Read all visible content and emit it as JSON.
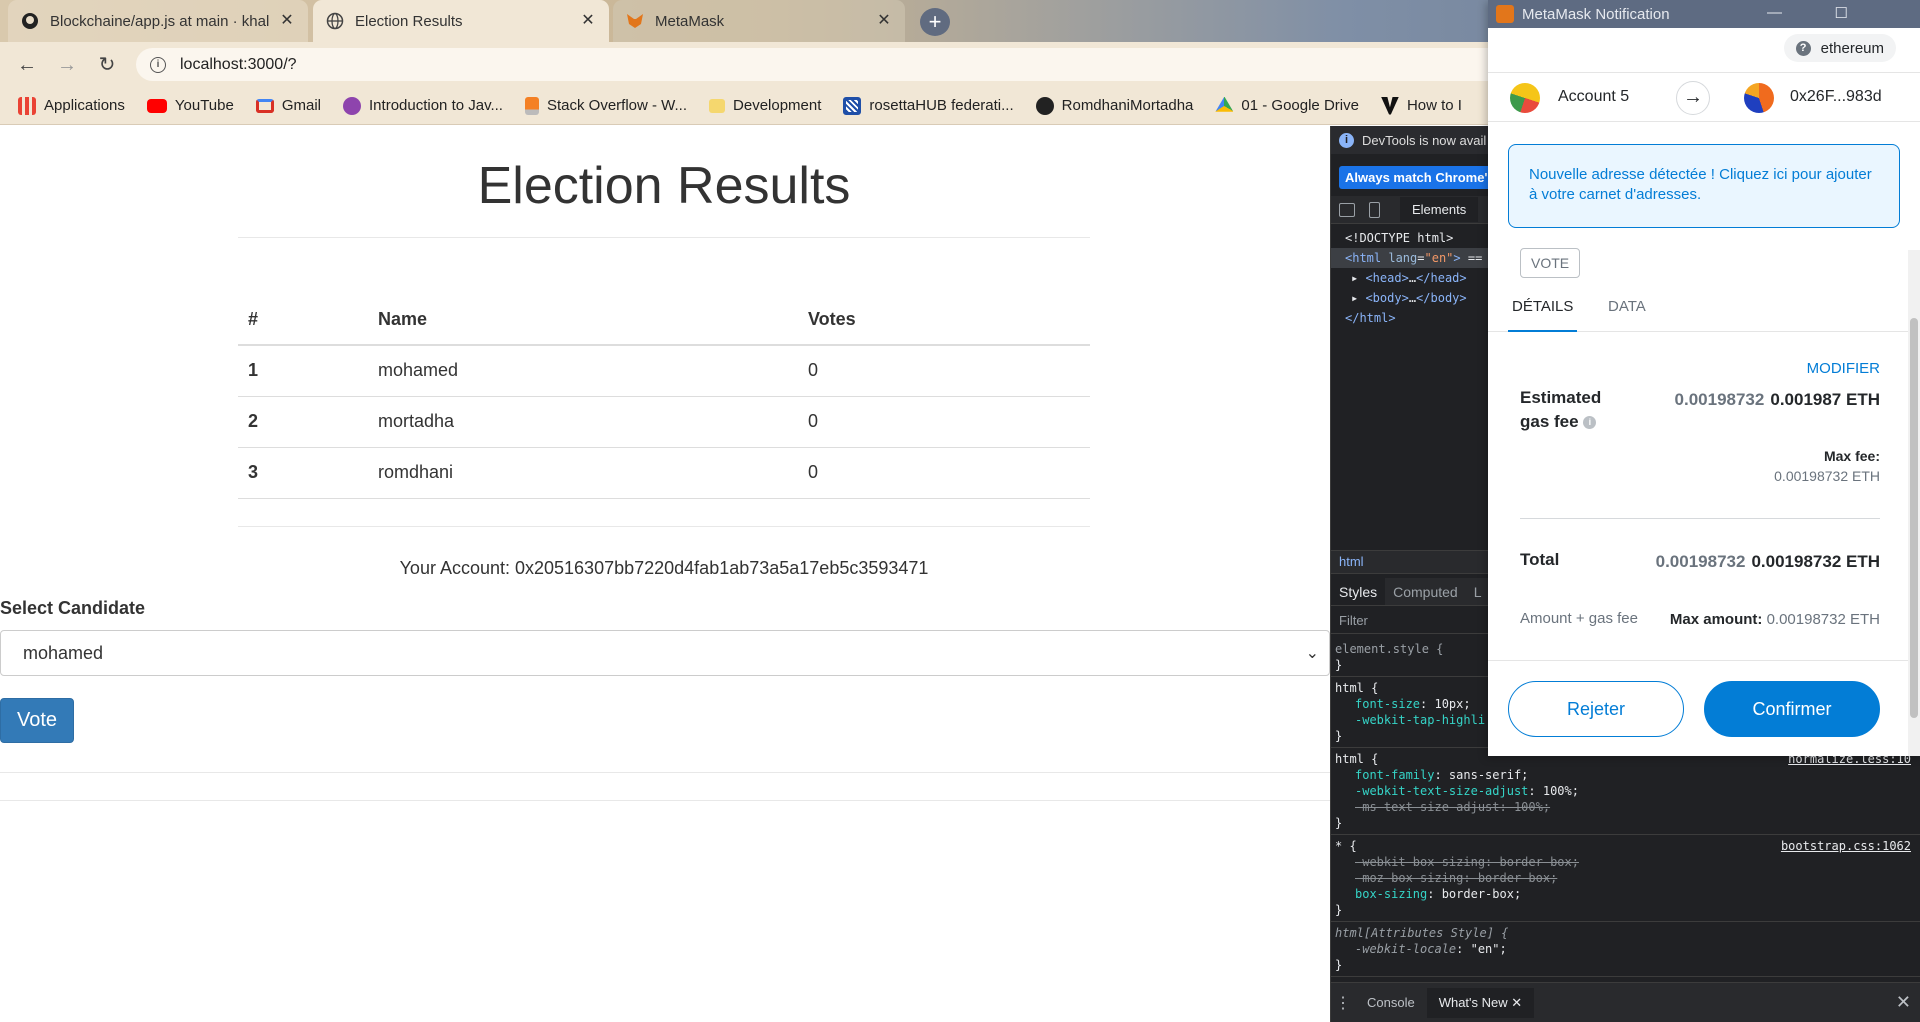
{
  "browser": {
    "tabs": [
      {
        "label": "Blockchaine/app.js at main · khal",
        "icon": "github-icon"
      },
      {
        "label": "Election Results",
        "icon": "globe-icon"
      },
      {
        "label": "MetaMask",
        "icon": "metamask-fox-icon"
      }
    ],
    "url": "localhost:3000/?",
    "bookmarks": [
      {
        "label": "Applications",
        "icon": "apps-grid-icon",
        "color": "#ea4335"
      },
      {
        "label": "YouTube",
        "icon": "youtube-icon",
        "color": "#ff0000"
      },
      {
        "label": "Gmail",
        "icon": "gmail-icon",
        "color": "#d93025"
      },
      {
        "label": "Introduction to Jav...",
        "icon": "course-icon",
        "color": "#8e44ad"
      },
      {
        "label": "Stack Overflow - W...",
        "icon": "stackoverflow-icon",
        "color": "#f48024"
      },
      {
        "label": "Development",
        "icon": "folder-icon",
        "color": "#f5d76e"
      },
      {
        "label": "rosettaHUB federati...",
        "icon": "rosettahub-icon",
        "color": "#1f4fa8"
      },
      {
        "label": "RomdhaniMortadha",
        "icon": "github-icon",
        "color": "#222222"
      },
      {
        "label": "01 - Google Drive",
        "icon": "google-drive-icon",
        "color": "#34a853"
      },
      {
        "label": "How to I",
        "icon": "v-icon",
        "color": "#111111"
      }
    ]
  },
  "page": {
    "title": "Election Results",
    "table": {
      "headers": [
        "#",
        "Name",
        "Votes"
      ],
      "rows": [
        [
          "1",
          "mohamed",
          "0"
        ],
        [
          "2",
          "mortadha",
          "0"
        ],
        [
          "3",
          "romdhani",
          "0"
        ]
      ]
    },
    "account_line": "Your Account: 0x20516307bb7220d4fab1ab73a5a17eb5c3593471",
    "select_label": "Select Candidate",
    "selected_candidate": "mohamed",
    "vote_button": "Vote"
  },
  "devtools": {
    "banner": "DevTools is now avail",
    "match_button": "Always match Chrome's",
    "elements_tab": "Elements",
    "breadcrumb": "html",
    "style_tabs": [
      "Styles",
      "Computed",
      "L"
    ],
    "filter_placeholder": "Filter",
    "sources": [
      "normalize.less:10",
      "bootstrap.css:1062"
    ],
    "drawer_tabs": [
      "Console",
      "What's New"
    ]
  },
  "metamask": {
    "window_title": "MetaMask Notification",
    "network": "ethereum",
    "from_account": "Account 5",
    "to_address": "0x26F...983d",
    "notice": "Nouvelle adresse détectée ! Cliquez ici pour ajouter à votre carnet d'adresses.",
    "method": "VOTE",
    "tabs": [
      "DÉTAILS",
      "DATA"
    ],
    "modify": "MODIFIER",
    "gas_label": "Estimated gas fee",
    "gas_value_primary": "0.00198732",
    "gas_value_eth": "0.001987 ETH",
    "max_fee_label": "Max fee:",
    "max_fee_value": "0.00198732 ETH",
    "total_label": "Total",
    "total_value_primary": "0.00198732",
    "total_value_eth": "0.00198732 ETH",
    "amount_gas_label": "Amount + gas fee",
    "max_amount_label": "Max amount:",
    "max_amount_value": "0.00198732 ETH",
    "reject": "Rejeter",
    "confirm": "Confirmer",
    "accent": "#037dd6"
  }
}
